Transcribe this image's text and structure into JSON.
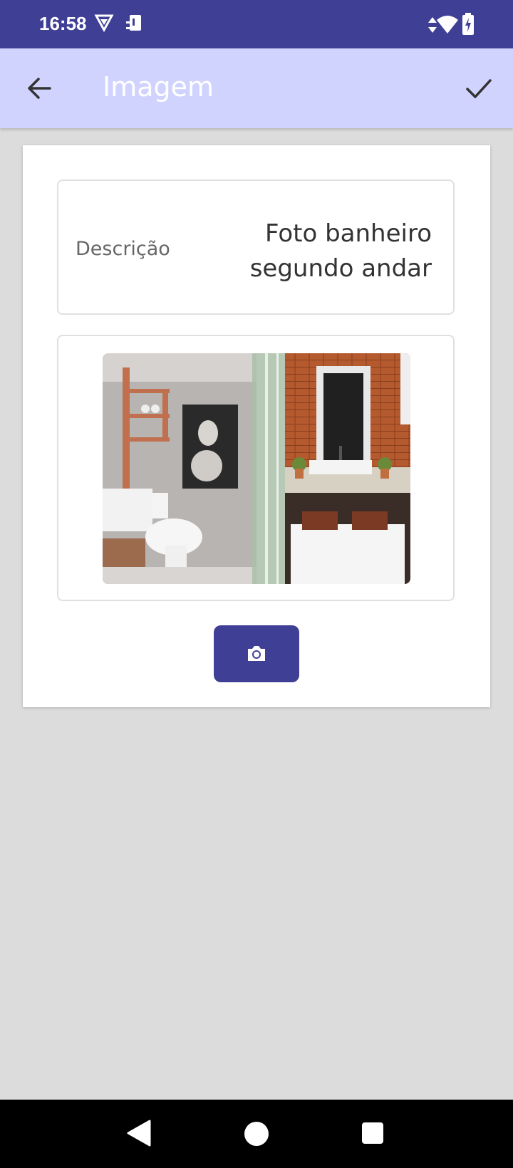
{
  "status_bar": {
    "time": "16:58",
    "icons": [
      "vpn-shield-icon",
      "sim-card-icon",
      "data-arrows-icon",
      "wifi-icon",
      "battery-charging-icon"
    ]
  },
  "app_bar": {
    "title": "Imagem",
    "back_icon": "arrow-left-icon",
    "confirm_icon": "check-icon"
  },
  "form": {
    "description_label": "Descrição",
    "description_value": "Foto banheiro segundo andar"
  },
  "image": {
    "icon": "bathroom-photo"
  },
  "camera_button": {
    "icon": "camera-icon"
  },
  "colors": {
    "status_bar": "#3f3f95",
    "app_bar": "#d1d3ff",
    "accent": "#3f3f95",
    "background": "#dcdcdc"
  },
  "nav_bar": {
    "icons": [
      "back-triangle-icon",
      "home-circle-icon",
      "recents-square-icon"
    ]
  }
}
